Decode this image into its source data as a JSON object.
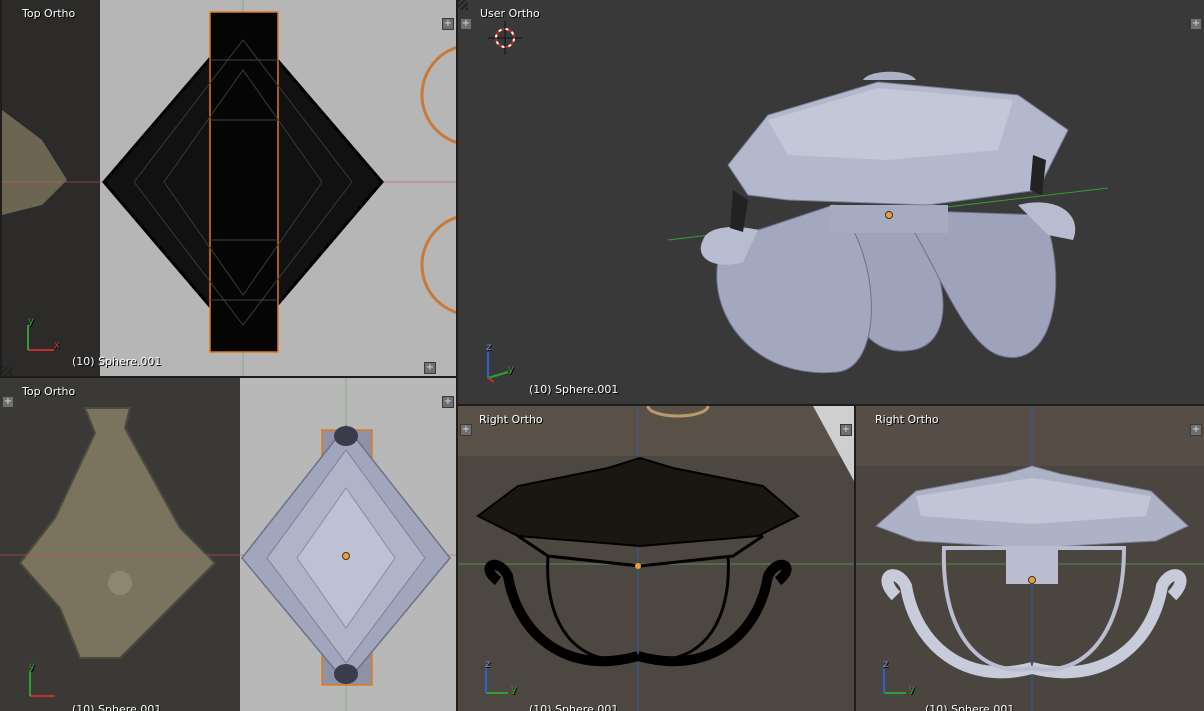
{
  "viewports": {
    "top_left": {
      "title": "Top Ortho",
      "object": "(10) Sphere.001"
    },
    "top_right": {
      "title": "User Ortho",
      "object": "(10) Sphere.001"
    },
    "bottom_left": {
      "title": "Top Ortho",
      "object": "(10) Sphere.001"
    },
    "bottom_mid": {
      "title": "Right Ortho",
      "object": "(10) Sphere.001"
    },
    "bottom_right": {
      "title": "Right Ortho",
      "object": "(10) Sphere.001"
    }
  },
  "axes": {
    "x": "x",
    "y": "y",
    "z": "z"
  },
  "colors": {
    "viewport_dark": "#393939",
    "viewport_light": "#b5b5b5",
    "mesh_solid": "#8f93ac",
    "wire": "#000000",
    "selection_outline": "#e07a1a",
    "axis_x": "#c03030",
    "axis_y": "#2fa02f",
    "axis_z": "#2f5fd0"
  }
}
